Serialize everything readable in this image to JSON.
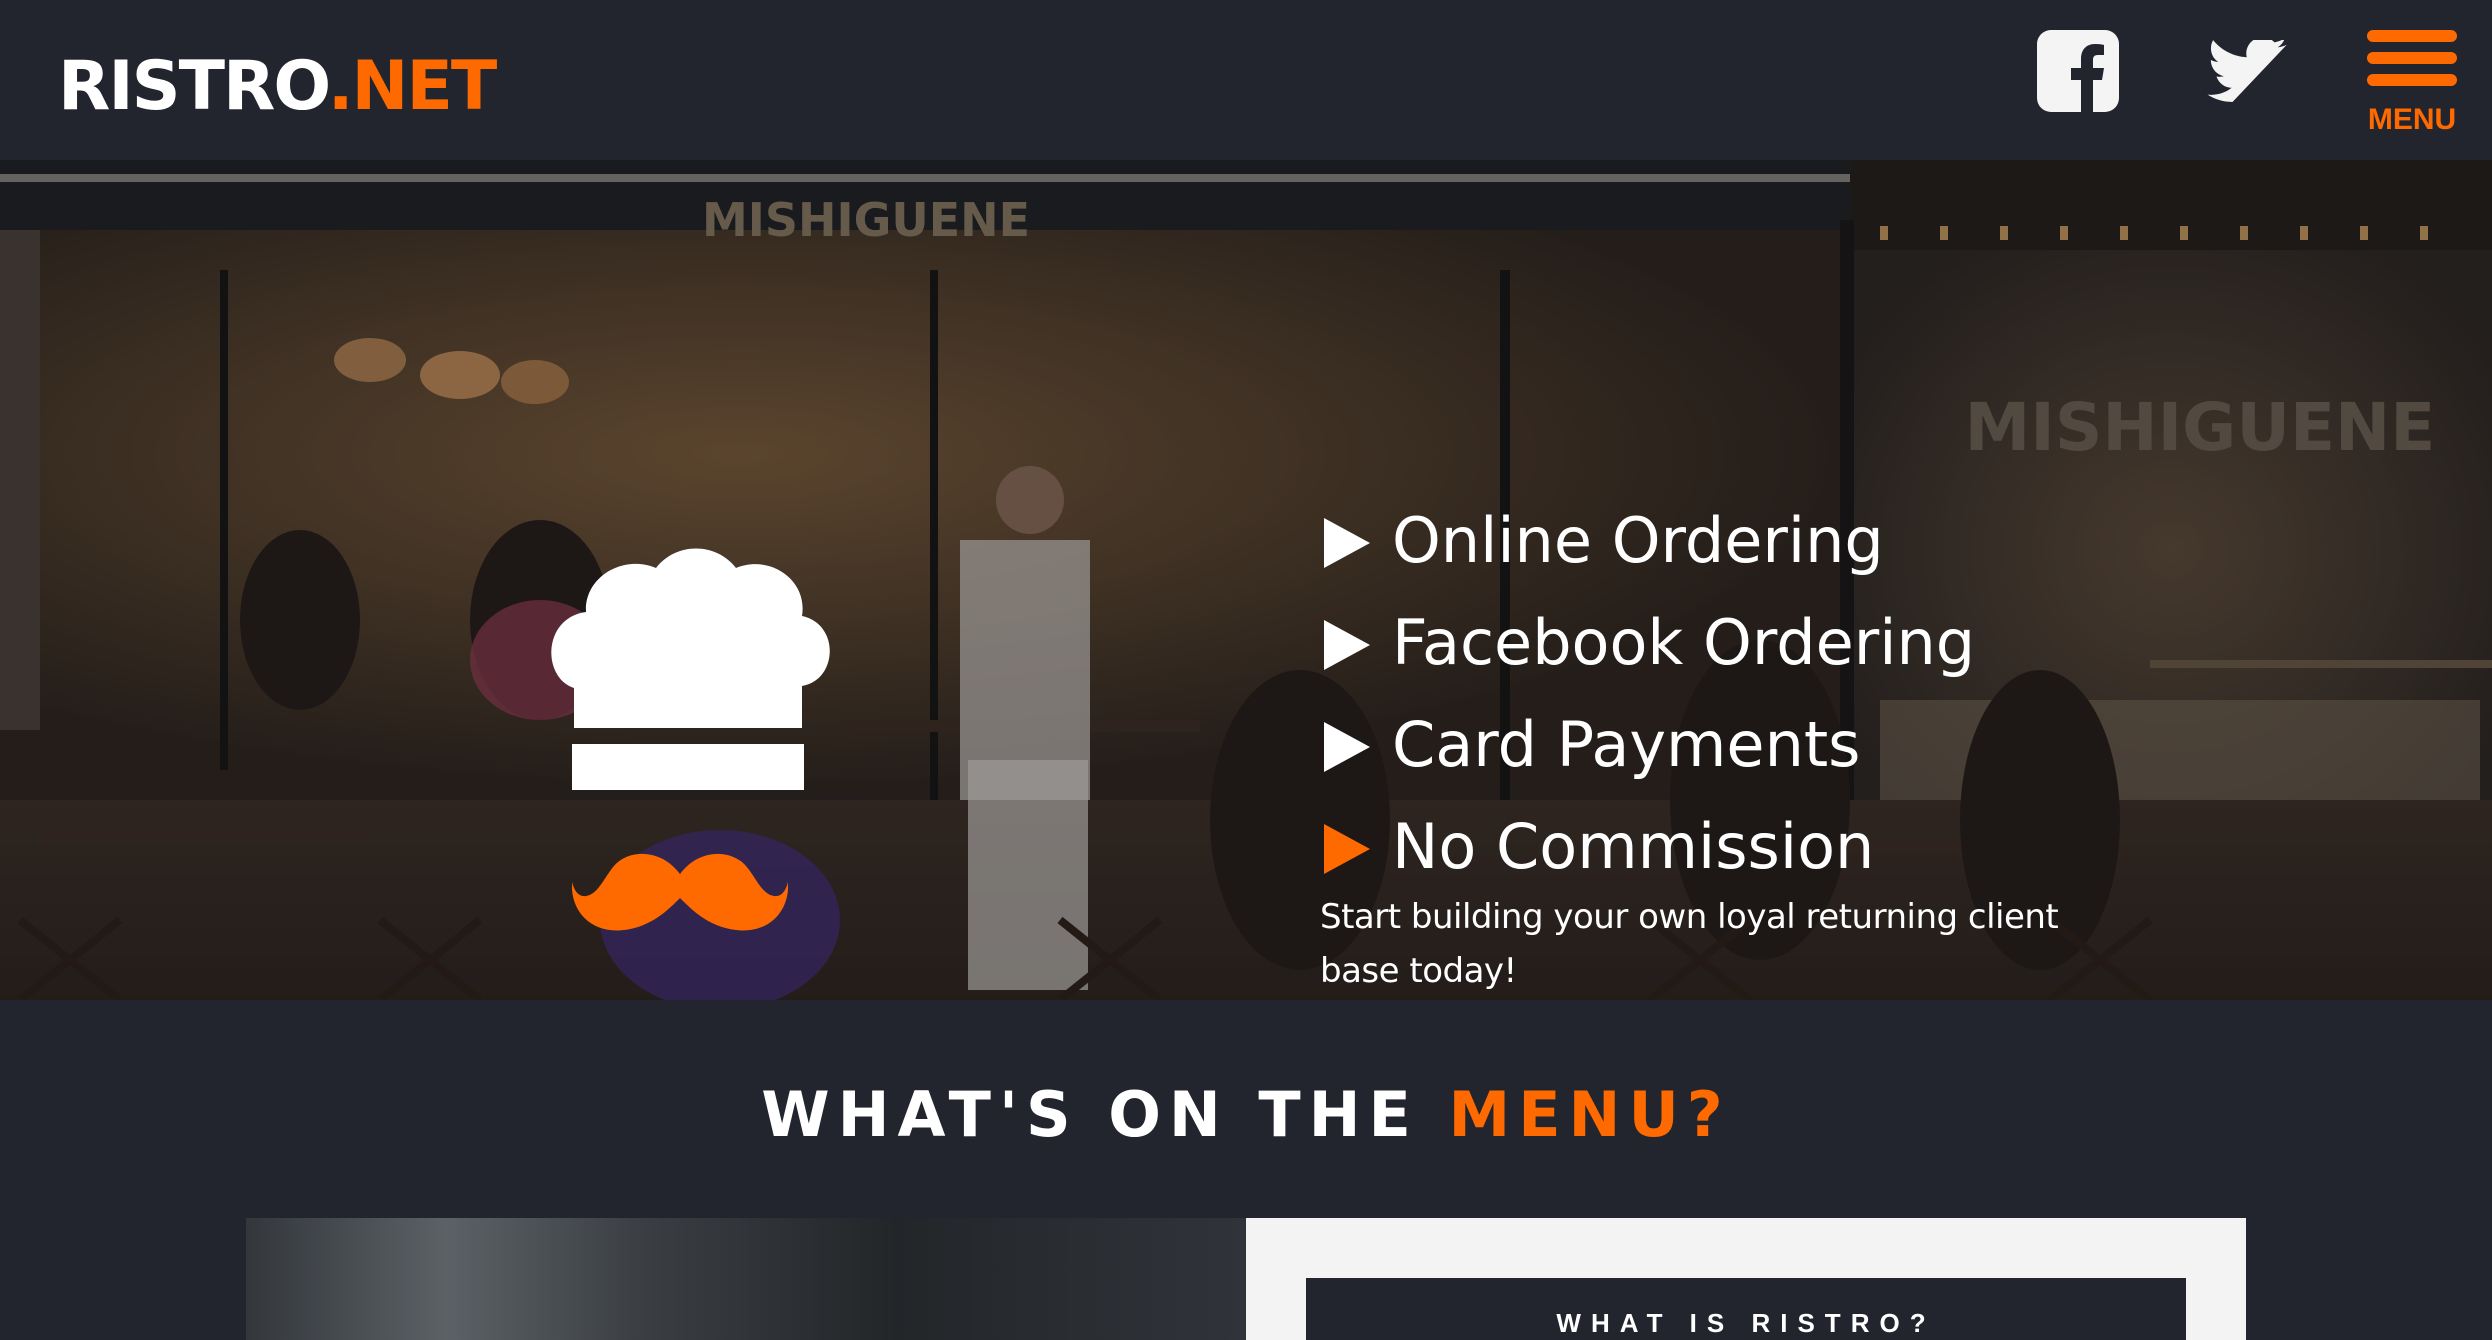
{
  "header": {
    "logo_main": "RISTRO",
    "logo_accent": ".NET",
    "facebook_icon": "facebook-icon",
    "twitter_icon": "twitter-icon",
    "menu_icon": "hamburger-menu-icon",
    "menu_label": "MENU"
  },
  "hero": {
    "features": [
      {
        "label": "Online Ordering",
        "bullet_color": "#ffffff"
      },
      {
        "label": "Facebook Ordering",
        "bullet_color": "#ffffff"
      },
      {
        "label": "Card Payments",
        "bullet_color": "#ffffff"
      },
      {
        "label": "No Commission",
        "bullet_color": "#ff6a00"
      }
    ],
    "tagline": "Start building your own loyal returning client base today!",
    "photo_sign_left": "MISHIGUENE",
    "photo_sign_right": "MISHIGUENE",
    "chef_hat_icon": "chef-hat-icon",
    "mustache_icon": "mustache-icon"
  },
  "section": {
    "title_white": "WHAT'S ON THE",
    "title_orange": "MENU?",
    "card_title": "WHAT IS RISTRO?"
  },
  "colors": {
    "background": "#22252d",
    "accent": "#ff6a00",
    "text": "#ffffff",
    "panel": "#f3f3f3"
  }
}
